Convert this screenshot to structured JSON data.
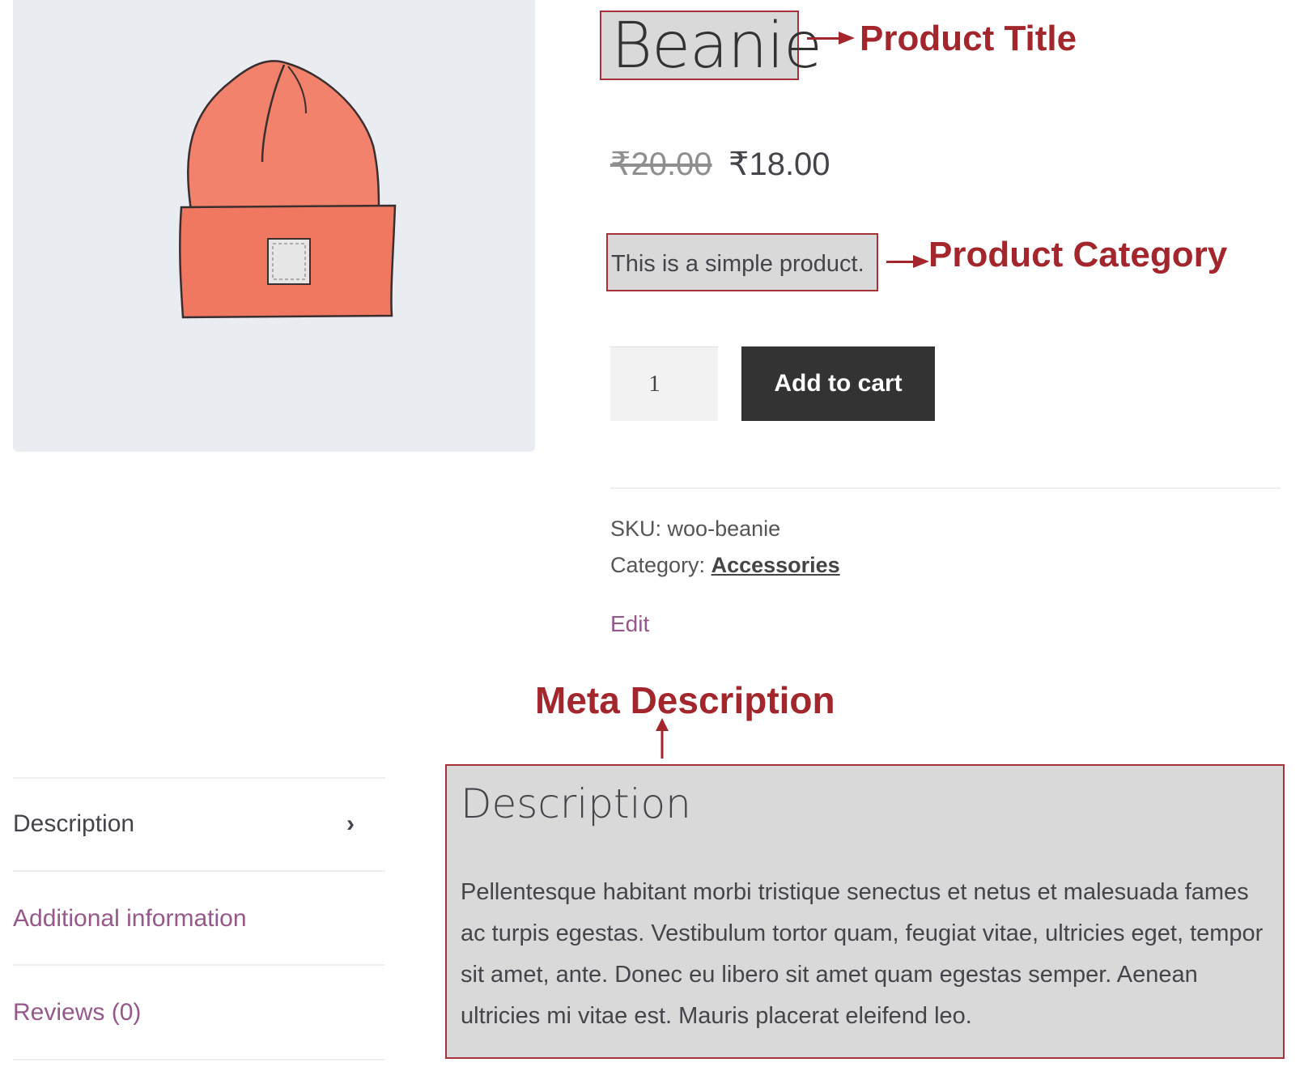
{
  "product": {
    "title": "Beanie",
    "price_old": "₹20.00",
    "price_new": "₹18.00",
    "short_description": "This is a simple product.",
    "quantity": "1",
    "add_to_cart_label": "Add to cart",
    "sku_label": "SKU:",
    "sku_value": "woo-beanie",
    "category_label": "Category:",
    "category_value": "Accessories",
    "edit_label": "Edit"
  },
  "annotations": {
    "title": "Product Title",
    "category": "Product Category",
    "meta": "Meta Description"
  },
  "tabs": [
    {
      "label": "Description",
      "active": true
    },
    {
      "label": "Additional information",
      "active": false
    },
    {
      "label": "Reviews (0)",
      "active": false
    }
  ],
  "description": {
    "heading": "Description",
    "body": "Pellentesque habitant morbi tristique senectus et netus et malesuada fames ac turpis egestas. Vestibulum tortor quam, feugiat vitae, ultricies eget, tempor sit amet, ante. Donec eu libero sit amet quam egestas semper. Aenean ultricies mi vitae est. Mauris placerat eleifend leo."
  },
  "colors": {
    "annotation": "#a3262d",
    "link": "#96588a",
    "button": "#333333",
    "image_bg": "#e9edf1"
  },
  "icons": {
    "tab_active": "chevron-right-icon",
    "image": "beanie-illustration"
  }
}
